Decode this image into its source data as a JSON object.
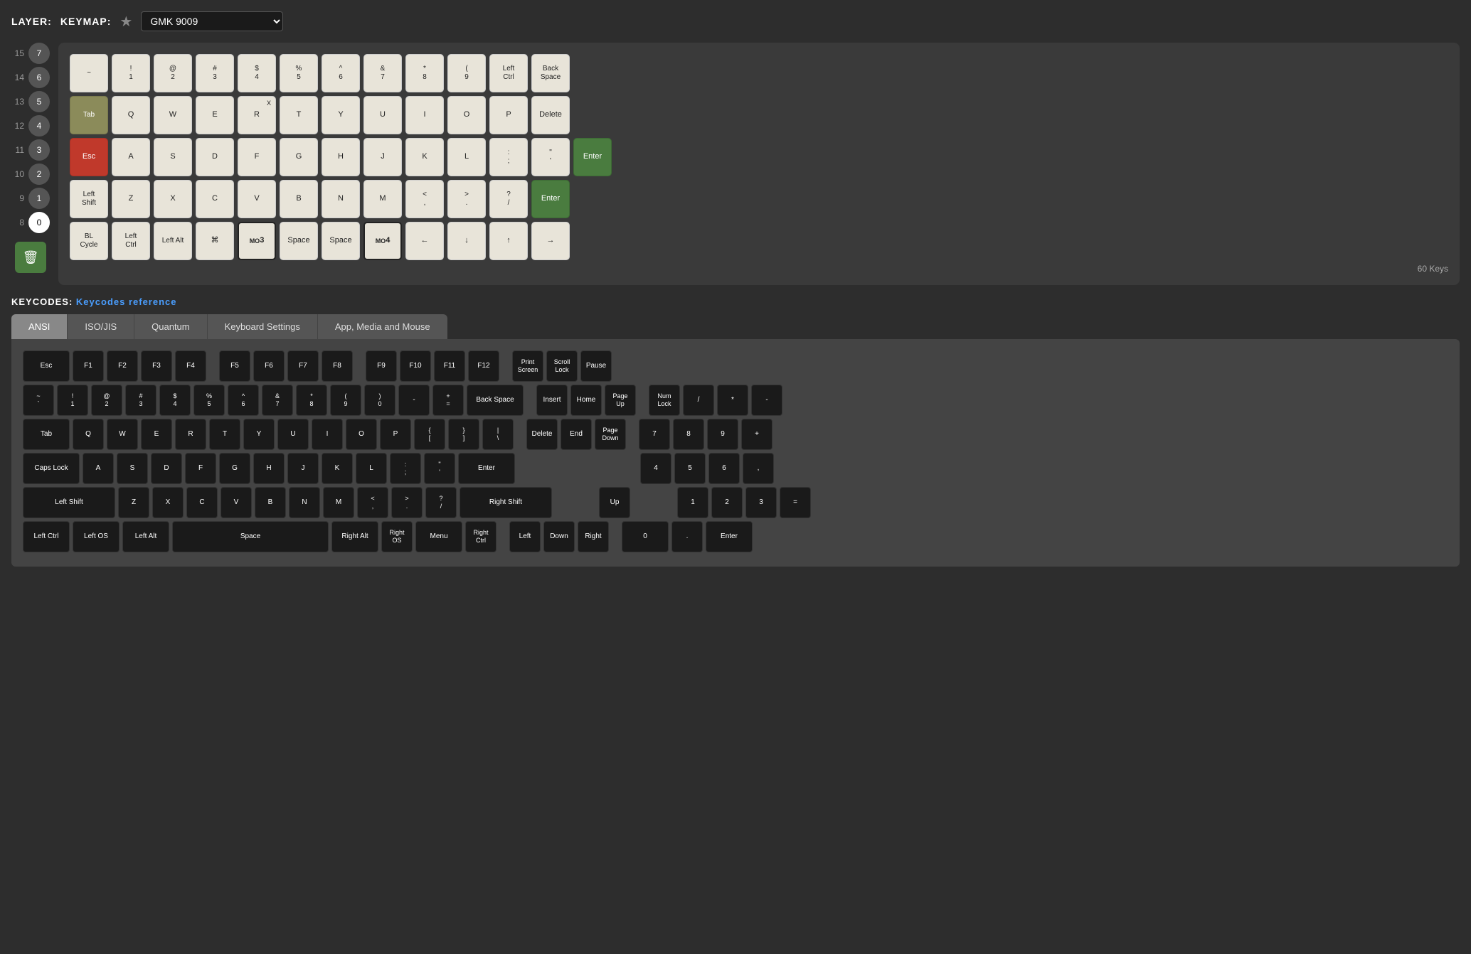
{
  "header": {
    "layer_label": "LAYER:",
    "keymap_label": "KEYMAP:",
    "keymap_value": "GMK 9009"
  },
  "layers": [
    {
      "num": 15,
      "circle": 7
    },
    {
      "num": 14,
      "circle": 6
    },
    {
      "num": 13,
      "circle": 5
    },
    {
      "num": 12,
      "circle": 4
    },
    {
      "num": 11,
      "circle": 3
    },
    {
      "num": 10,
      "circle": 2
    },
    {
      "num": 9,
      "circle": 1
    },
    {
      "num": 8,
      "circle": 0,
      "active": true
    }
  ],
  "keyboard": {
    "key_count": "60 Keys",
    "rows": [
      [
        "~",
        "!\n1",
        "@\n2",
        "#\n3",
        "$\n4",
        "%\n5",
        "^\n6",
        "&\n7",
        "*\n8",
        "(\n9",
        "Left\nCtrl",
        "Back\nSpace"
      ],
      [
        "Tab",
        "Q",
        "W",
        "E",
        "R",
        "T",
        "Y",
        "U",
        "I",
        "O",
        "P",
        "Delete"
      ],
      [
        "Esc",
        "A",
        "S",
        "D",
        "F",
        "G",
        "H",
        "J",
        "K",
        "L",
        ":",
        "\"",
        "Enter"
      ],
      [
        "Left\nShift",
        "Z",
        "X",
        "C",
        "V",
        "B",
        "N",
        "M",
        "<\n,",
        ">\n.",
        "?\n/",
        "Enter"
      ],
      [
        "BL\nCycle",
        "Left\nCtrl",
        "Left Alt",
        "⌘",
        "MO\n3",
        "Space",
        "Space",
        "MO\n4",
        "←",
        "↓",
        "↑",
        "→"
      ]
    ]
  },
  "keycodes": {
    "header": "KEYCODES:",
    "link_text": "Keycodes reference",
    "tabs": [
      "ANSI",
      "ISO/JIS",
      "Quantum",
      "Keyboard Settings",
      "App, Media and Mouse"
    ]
  },
  "ansi": {
    "row1": [
      "Esc",
      "F1",
      "F2",
      "F3",
      "F4",
      "F5",
      "F6",
      "F7",
      "F8",
      "F9",
      "F10",
      "F11",
      "F12",
      "Print\nScreen",
      "Scroll\nLock",
      "Pause"
    ],
    "row2": [
      "~\n`",
      "!\n1",
      "@\n2",
      "#\n3",
      "$\n4",
      "%\n5",
      "^\n6",
      "&\n7",
      "*\n8",
      "(\n9",
      ")\n0",
      "-",
      "+\n=",
      "Back Space",
      "Insert",
      "Home",
      "Page\nUp",
      "Num\nLock",
      "/",
      "*",
      "-"
    ],
    "row3": [
      "Tab",
      "Q",
      "W",
      "E",
      "R",
      "T",
      "Y",
      "U",
      "I",
      "O",
      "P",
      "{\n[",
      "}\n]",
      "|\n\\",
      "Delete",
      "End",
      "Page\nDown",
      "7",
      "8",
      "9",
      "+"
    ],
    "row4": [
      "Caps Lock",
      "A",
      "S",
      "D",
      "F",
      "G",
      "H",
      "J",
      "K",
      "L",
      ":\n;",
      "\"\n'",
      "Enter",
      "4",
      "5",
      "6",
      ","
    ],
    "row5": [
      "Left Shift",
      "Z",
      "X",
      "C",
      "V",
      "B",
      "N",
      "M",
      "<\n,",
      ">\n.",
      "?\n/",
      "Right Shift",
      "Up",
      "1",
      "2",
      "3",
      "="
    ],
    "row6": [
      "Left Ctrl",
      "Left OS",
      "Left Alt",
      "Space",
      "Right Alt",
      "Right\nOS",
      "Menu",
      "Right\nCtrl",
      "Left",
      "Down",
      "Right",
      "0",
      ".",
      "Enter"
    ]
  }
}
